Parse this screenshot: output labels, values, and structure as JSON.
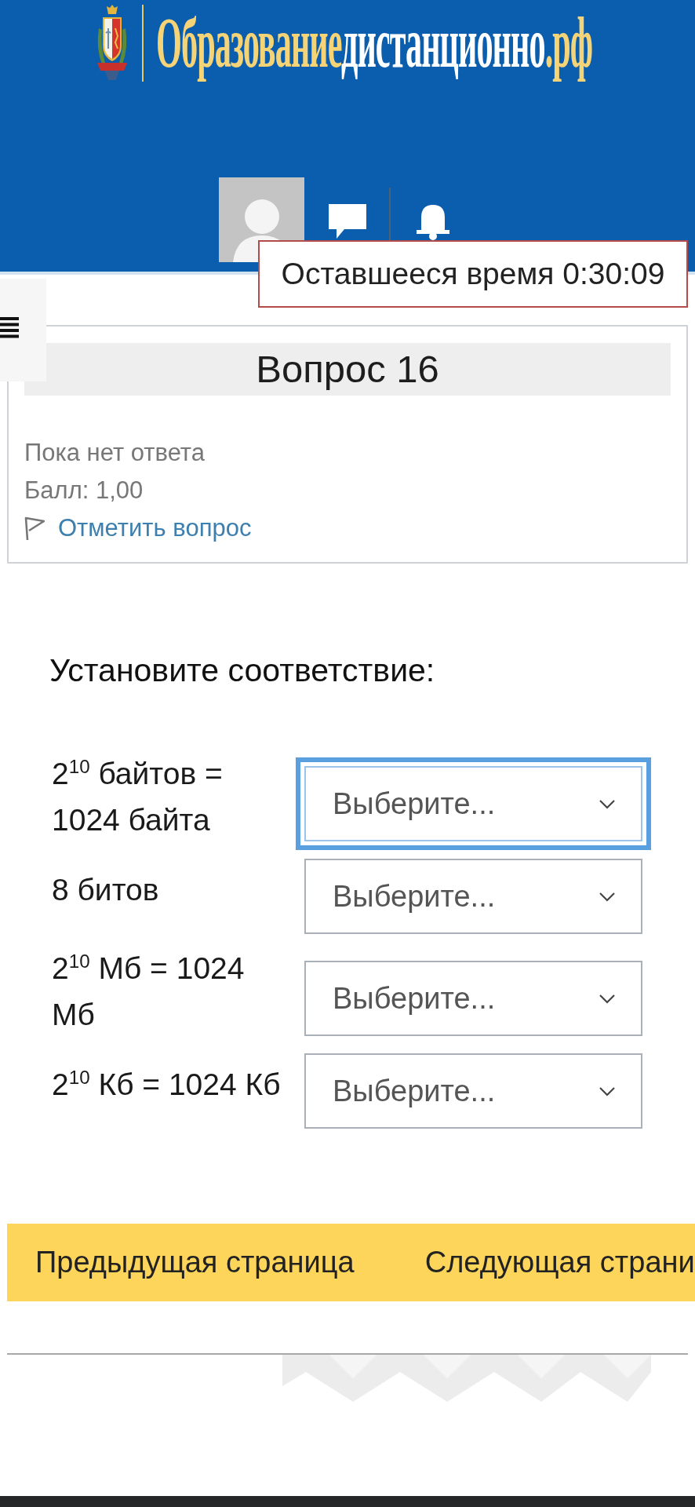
{
  "header": {
    "logo": {
      "parts": [
        "Образование",
        "дистанционно",
        ".рф"
      ]
    }
  },
  "timer": "Оставшееся время 0:30:09",
  "question": {
    "title": "Вопрос 16",
    "status": "Пока нет ответа",
    "grade": "Балл: 1,00",
    "flag": {
      "label": "Отметить вопрос",
      "flagged": false
    }
  },
  "matching": {
    "prompt": "Установите соответствие:",
    "rows": [
      {
        "label": "2$^{10}$ байтов = 1024 байта",
        "value": "Выберите...",
        "focused": true
      },
      {
        "label": "8 битов",
        "value": "Выберите...",
        "focused": false
      },
      {
        "label": "2$^{10}$ Мб = 1024 Мб",
        "value": "Выберите...",
        "focused": false
      },
      {
        "label": "2$^{10}$ Кб = 1024 Кб",
        "value": "Выберите...",
        "focused": false
      }
    ]
  },
  "navigation": {
    "buttons": [
      "Предыдущая страница",
      "Следующая страни"
    ]
  }
}
